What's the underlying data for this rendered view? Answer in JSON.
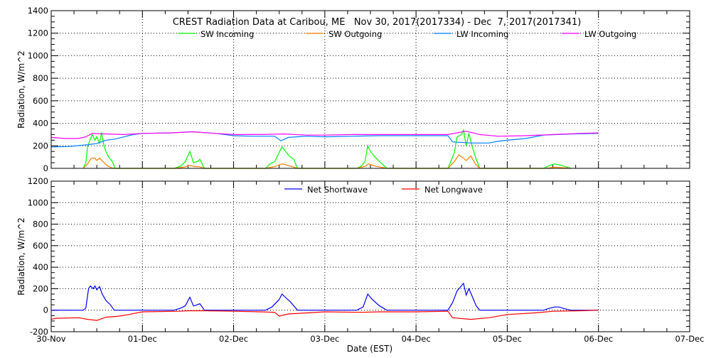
{
  "chart_data": [
    {
      "type": "line",
      "title": "CREST Radiation Data at Caribou, ME   Nov 30, 2017(2017334) - Dec  7, 2017(2017341)",
      "xlabel": "",
      "ylabel": "Radiation, W/m^2",
      "ylim": [
        0,
        1400
      ],
      "yticks": [
        0,
        200,
        400,
        600,
        800,
        1000,
        1200,
        1400
      ],
      "xlim": [
        0,
        7
      ],
      "grid": true,
      "legend_position": "top",
      "series": [
        {
          "name": "SW Incoming",
          "color": "#00ff00",
          "points": [
            [
              0.35,
              0
            ],
            [
              0.38,
              50
            ],
            [
              0.4,
              200
            ],
            [
              0.43,
              260
            ],
            [
              0.45,
              300
            ],
            [
              0.48,
              250
            ],
            [
              0.5,
              280
            ],
            [
              0.53,
              220
            ],
            [
              0.55,
              320
            ],
            [
              0.58,
              200
            ],
            [
              0.6,
              150
            ],
            [
              0.63,
              100
            ],
            [
              0.67,
              60
            ],
            [
              0.7,
              0
            ],
            [
              1.35,
              0
            ],
            [
              1.42,
              20
            ],
            [
              1.47,
              60
            ],
            [
              1.52,
              150
            ],
            [
              1.56,
              50
            ],
            [
              1.6,
              60
            ],
            [
              1.63,
              80
            ],
            [
              1.68,
              0
            ],
            [
              2.35,
              0
            ],
            [
              2.4,
              40
            ],
            [
              2.45,
              60
            ],
            [
              2.5,
              140
            ],
            [
              2.53,
              190
            ],
            [
              2.58,
              140
            ],
            [
              2.62,
              100
            ],
            [
              2.66,
              80
            ],
            [
              2.7,
              0
            ],
            [
              3.35,
              0
            ],
            [
              3.4,
              20
            ],
            [
              3.44,
              60
            ],
            [
              3.47,
              200
            ],
            [
              3.5,
              150
            ],
            [
              3.54,
              110
            ],
            [
              3.6,
              60
            ],
            [
              3.68,
              0
            ],
            [
              4.35,
              0
            ],
            [
              4.38,
              60
            ],
            [
              4.42,
              140
            ],
            [
              4.45,
              280
            ],
            [
              4.5,
              300
            ],
            [
              4.52,
              340
            ],
            [
              4.55,
              200
            ],
            [
              4.58,
              310
            ],
            [
              4.62,
              180
            ],
            [
              4.66,
              80
            ],
            [
              4.7,
              0
            ],
            [
              5.4,
              0
            ],
            [
              5.45,
              20
            ],
            [
              5.52,
              40
            ],
            [
              5.57,
              30
            ],
            [
              5.62,
              20
            ],
            [
              5.7,
              0
            ]
          ]
        },
        {
          "name": "SW Outgoing",
          "color": "#ff7f00",
          "points": [
            [
              0.35,
              0
            ],
            [
              0.4,
              40
            ],
            [
              0.44,
              90
            ],
            [
              0.48,
              90
            ],
            [
              0.5,
              70
            ],
            [
              0.53,
              90
            ],
            [
              0.58,
              50
            ],
            [
              0.62,
              20
            ],
            [
              0.68,
              0
            ],
            [
              1.35,
              0
            ],
            [
              1.45,
              10
            ],
            [
              1.52,
              25
            ],
            [
              1.58,
              15
            ],
            [
              1.62,
              15
            ],
            [
              1.68,
              0
            ],
            [
              2.35,
              0
            ],
            [
              2.45,
              15
            ],
            [
              2.53,
              40
            ],
            [
              2.6,
              25
            ],
            [
              2.7,
              0
            ],
            [
              3.35,
              0
            ],
            [
              3.45,
              20
            ],
            [
              3.48,
              40
            ],
            [
              3.55,
              20
            ],
            [
              3.68,
              0
            ],
            [
              4.35,
              0
            ],
            [
              4.42,
              60
            ],
            [
              4.47,
              120
            ],
            [
              4.52,
              90
            ],
            [
              4.55,
              70
            ],
            [
              4.6,
              110
            ],
            [
              4.65,
              40
            ],
            [
              4.7,
              0
            ],
            [
              5.42,
              0
            ],
            [
              5.52,
              10
            ],
            [
              5.62,
              5
            ],
            [
              5.7,
              0
            ]
          ]
        },
        {
          "name": "LW Incoming",
          "color": "#0080ff",
          "points": [
            [
              0,
              190
            ],
            [
              0.2,
              195
            ],
            [
              0.4,
              210
            ],
            [
              0.5,
              220
            ],
            [
              0.6,
              250
            ],
            [
              0.7,
              260
            ],
            [
              0.8,
              280
            ],
            [
              0.9,
              300
            ],
            [
              1.0,
              310
            ],
            [
              1.3,
              315
            ],
            [
              1.55,
              325
            ],
            [
              1.8,
              310
            ],
            [
              2.0,
              290
            ],
            [
              2.2,
              285
            ],
            [
              2.45,
              285
            ],
            [
              2.52,
              245
            ],
            [
              2.6,
              275
            ],
            [
              2.8,
              285
            ],
            [
              3.0,
              280
            ],
            [
              3.3,
              285
            ],
            [
              3.6,
              290
            ],
            [
              4.0,
              290
            ],
            [
              4.35,
              290
            ],
            [
              4.4,
              235
            ],
            [
              4.6,
              225
            ],
            [
              4.8,
              225
            ],
            [
              4.9,
              240
            ],
            [
              5.0,
              250
            ],
            [
              5.2,
              265
            ],
            [
              5.4,
              295
            ],
            [
              5.7,
              305
            ],
            [
              6.0,
              310
            ]
          ]
        },
        {
          "name": "LW Outgoing",
          "color": "#ff00ff",
          "points": [
            [
              0,
              275
            ],
            [
              0.15,
              265
            ],
            [
              0.3,
              265
            ],
            [
              0.38,
              280
            ],
            [
              0.45,
              310
            ],
            [
              0.6,
              305
            ],
            [
              0.8,
              300
            ],
            [
              1.0,
              310
            ],
            [
              1.3,
              315
            ],
            [
              1.55,
              325
            ],
            [
              1.8,
              310
            ],
            [
              2.0,
              300
            ],
            [
              2.3,
              300
            ],
            [
              2.55,
              305
            ],
            [
              2.8,
              295
            ],
            [
              3.0,
              295
            ],
            [
              3.3,
              300
            ],
            [
              3.6,
              300
            ],
            [
              4.0,
              300
            ],
            [
              4.35,
              300
            ],
            [
              4.55,
              330
            ],
            [
              4.7,
              300
            ],
            [
              4.9,
              285
            ],
            [
              5.2,
              290
            ],
            [
              5.5,
              300
            ],
            [
              5.8,
              310
            ],
            [
              6.0,
              315
            ]
          ]
        }
      ]
    },
    {
      "type": "line",
      "title": "",
      "xlabel": "Date (EST)",
      "ylabel": "Radiation, W/m^2",
      "ylim": [
        -200,
        1200
      ],
      "yticks": [
        -200,
        0,
        200,
        400,
        600,
        800,
        1000,
        1200
      ],
      "xlim": [
        0,
        7
      ],
      "xticks": [
        "30-Nov",
        "01-Dec",
        "02-Dec",
        "03-Dec",
        "04-Dec",
        "05-Dec",
        "06-Dec",
        "07-Dec"
      ],
      "grid": true,
      "legend_position": "top",
      "series": [
        {
          "name": "Net Shortwave",
          "color": "#0000ff",
          "points": [
            [
              0,
              0
            ],
            [
              0.35,
              0
            ],
            [
              0.38,
              20
            ],
            [
              0.41,
              200
            ],
            [
              0.43,
              225
            ],
            [
              0.46,
              200
            ],
            [
              0.48,
              225
            ],
            [
              0.5,
              190
            ],
            [
              0.53,
              220
            ],
            [
              0.56,
              150
            ],
            [
              0.6,
              90
            ],
            [
              0.65,
              50
            ],
            [
              0.69,
              0
            ],
            [
              1.35,
              0
            ],
            [
              1.42,
              20
            ],
            [
              1.47,
              40
            ],
            [
              1.52,
              120
            ],
            [
              1.56,
              40
            ],
            [
              1.6,
              50
            ],
            [
              1.63,
              60
            ],
            [
              1.68,
              0
            ],
            [
              2.35,
              0
            ],
            [
              2.42,
              30
            ],
            [
              2.5,
              100
            ],
            [
              2.53,
              150
            ],
            [
              2.58,
              110
            ],
            [
              2.62,
              80
            ],
            [
              2.7,
              0
            ],
            [
              3.35,
              0
            ],
            [
              3.42,
              30
            ],
            [
              3.47,
              150
            ],
            [
              3.52,
              100
            ],
            [
              3.6,
              40
            ],
            [
              3.68,
              0
            ],
            [
              4.35,
              0
            ],
            [
              4.4,
              70
            ],
            [
              4.45,
              180
            ],
            [
              4.52,
              250
            ],
            [
              4.55,
              140
            ],
            [
              4.58,
              200
            ],
            [
              4.62,
              120
            ],
            [
              4.66,
              40
            ],
            [
              4.7,
              0
            ],
            [
              5.4,
              0
            ],
            [
              5.45,
              15
            ],
            [
              5.52,
              30
            ],
            [
              5.57,
              30
            ],
            [
              5.62,
              15
            ],
            [
              5.7,
              0
            ],
            [
              6.0,
              0
            ]
          ]
        },
        {
          "name": "Net Longwave",
          "color": "#ff0000",
          "points": [
            [
              0,
              -85
            ],
            [
              0.05,
              -75
            ],
            [
              0.3,
              -70
            ],
            [
              0.4,
              -85
            ],
            [
              0.5,
              -95
            ],
            [
              0.55,
              -80
            ],
            [
              0.6,
              -65
            ],
            [
              0.75,
              -55
            ],
            [
              0.85,
              -40
            ],
            [
              1.0,
              -15
            ],
            [
              1.4,
              -10
            ],
            [
              1.5,
              -5
            ],
            [
              1.7,
              -5
            ],
            [
              2.0,
              -10
            ],
            [
              2.3,
              -15
            ],
            [
              2.45,
              -20
            ],
            [
              2.5,
              -55
            ],
            [
              2.6,
              -35
            ],
            [
              2.8,
              -25
            ],
            [
              3.0,
              -15
            ],
            [
              3.4,
              -20
            ],
            [
              3.6,
              -15
            ],
            [
              4.0,
              -15
            ],
            [
              4.35,
              -10
            ],
            [
              4.4,
              -70
            ],
            [
              4.6,
              -85
            ],
            [
              4.8,
              -70
            ],
            [
              5.0,
              -40
            ],
            [
              5.3,
              -25
            ],
            [
              5.5,
              -10
            ],
            [
              5.8,
              -5
            ],
            [
              6.0,
              0
            ]
          ]
        }
      ]
    }
  ]
}
